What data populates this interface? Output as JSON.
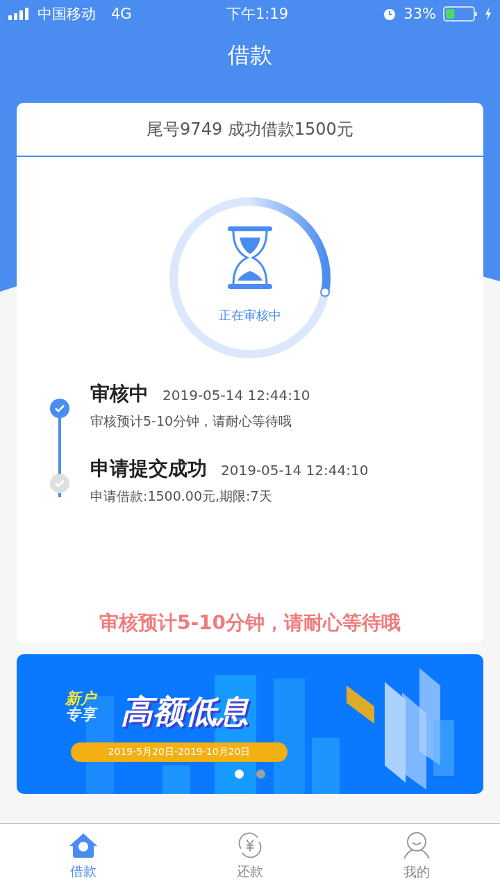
{
  "status_bar": {
    "carrier": "中国移动",
    "network": "4G",
    "time": "下午1:19",
    "battery": "33%"
  },
  "title": "借款",
  "card": {
    "header": "尾号9749 成功借款1500元",
    "progress": {
      "label": "正在审核中"
    },
    "steps": [
      {
        "title": "审核中",
        "time": "2019-05-14 12:44:10",
        "detail": "审核预计5-10分钟，请耐心等待哦",
        "active": true
      },
      {
        "title": "申请提交成功",
        "time": "2019-05-14 12:44:10",
        "detail": "申请借款:1500.00元,期限:7天",
        "active": false
      }
    ],
    "notice": "审核预计5-10分钟，请耐心等待哦"
  },
  "banner": {
    "tag_lines": [
      "新户",
      "专享"
    ],
    "headline": "高额低息",
    "dates": "2019-5月20日-2019-10月20日",
    "dots": [
      {
        "selected": true
      },
      {
        "selected": false
      }
    ]
  },
  "tab_bar": [
    {
      "label": "借款",
      "kind": "home",
      "selected": true
    },
    {
      "label": "还款",
      "kind": "repay",
      "selected": false
    },
    {
      "label": "我的",
      "kind": "user",
      "selected": false
    }
  ]
}
